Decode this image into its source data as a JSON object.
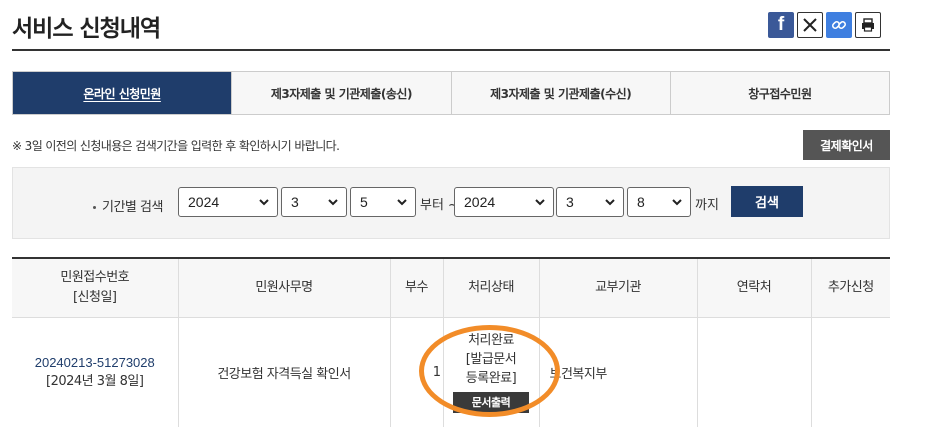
{
  "page_title": "서비스 신청내역",
  "share": {
    "facebook_glyph": "f",
    "icons": [
      "facebook-icon",
      "x-icon",
      "link-icon",
      "print-icon"
    ]
  },
  "tabs": [
    {
      "label": "온라인 신청민원",
      "active": true
    },
    {
      "label": "제3자제출 및 기관제출(송신)",
      "active": false
    },
    {
      "label": "제3자제출 및 기관제출(수신)",
      "active": false
    },
    {
      "label": "창구접수민원",
      "active": false
    }
  ],
  "notice": "※ 3일 이전의 신청내용은 검색기간을 입력한 후 확인하시기 바랍니다.",
  "confirm_button": "결제확인서",
  "search": {
    "label": "기간별 검색",
    "from_year": "2024",
    "from_month": "3",
    "from_day": "5",
    "from_suffix": "부터 ~",
    "to_year": "2024",
    "to_month": "3",
    "to_day": "8",
    "to_suffix": "까지",
    "button": "검색"
  },
  "table": {
    "headers": {
      "receipt_line1": "민원접수번호",
      "receipt_line2": "[신청일]",
      "name": "민원사무명",
      "copies": "부수",
      "status": "처리상태",
      "agency": "교부기관",
      "contact": "연락처",
      "extra": "추가신청"
    },
    "rows": [
      {
        "receipt_no": "20240213-51273028",
        "date": "[2024년 3월 8일]",
        "name": "건강보험 자격득실 확인서",
        "copies": "1",
        "status_line1": "처리완료",
        "status_line2": "[발급문서",
        "status_line3": "등록완료]",
        "print_button": "문서출력",
        "agency": "보건복지부",
        "contact": "",
        "extra": ""
      }
    ]
  },
  "colors": {
    "primary": "#1f3d6b",
    "highlight_ring": "#f28c28",
    "dark_button": "#555555"
  }
}
